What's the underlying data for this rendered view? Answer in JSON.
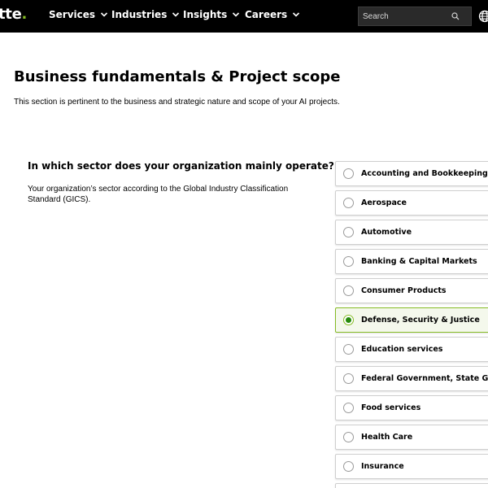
{
  "header": {
    "logo_text": "tte",
    "logo_dot": ".",
    "nav": [
      {
        "label": "Services"
      },
      {
        "label": "Industries"
      },
      {
        "label": "Insights"
      },
      {
        "label": "Careers"
      }
    ],
    "search": {
      "placeholder": "Search",
      "icon": "search-icon"
    },
    "globe_icon": "globe-icon"
  },
  "section": {
    "title": "Business fundamentals & Project scope",
    "description": "This section is pertinent to the business and strategic nature and scope of your AI projects."
  },
  "question": {
    "title": "In which sector does your organization mainly operate?",
    "help": "Your organization’s sector according to the Global Industry Classification Standard (GICS).",
    "options": [
      {
        "label": "Accounting and Bookkeeping",
        "selected": false
      },
      {
        "label": "Aerospace",
        "selected": false
      },
      {
        "label": "Automotive",
        "selected": false
      },
      {
        "label": "Banking & Capital Markets",
        "selected": false
      },
      {
        "label": "Consumer Products",
        "selected": false
      },
      {
        "label": "Defense, Security & Justice",
        "selected": true
      },
      {
        "label": "Education services",
        "selected": false
      },
      {
        "label": "Federal Government, State Gove",
        "selected": false
      },
      {
        "label": "Food services",
        "selected": false
      },
      {
        "label": "Health Care",
        "selected": false
      },
      {
        "label": "Insurance",
        "selected": false
      },
      {
        "label": "",
        "selected": false
      }
    ]
  },
  "colors": {
    "accent": "#86bc25",
    "selected_dot": "#26890d",
    "topbar": "#000000"
  }
}
